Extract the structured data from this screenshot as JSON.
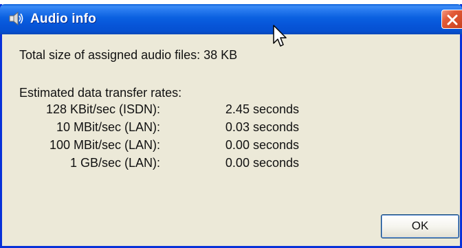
{
  "window": {
    "title": "Audio info",
    "title_icon": "speaker-icon",
    "close_icon": "close-icon"
  },
  "info": {
    "total_size_text": "Total size of assigned audio files:  38 KB",
    "rates_heading": "Estimated data transfer rates:",
    "rates": [
      {
        "label": "128 KBit/sec (ISDN):",
        "value": "2.45 seconds"
      },
      {
        "label": "10 MBit/sec (LAN):",
        "value": "0.03 seconds"
      },
      {
        "label": "100 MBit/sec (LAN):",
        "value": "0.00 seconds"
      },
      {
        "label": "1 GB/sec (LAN):",
        "value": "0.00 seconds"
      }
    ]
  },
  "buttons": {
    "ok_label": "OK"
  },
  "colors": {
    "titlebar": "#0a60e0",
    "window_body": "#ece9d8",
    "close_button": "#e25b38"
  }
}
